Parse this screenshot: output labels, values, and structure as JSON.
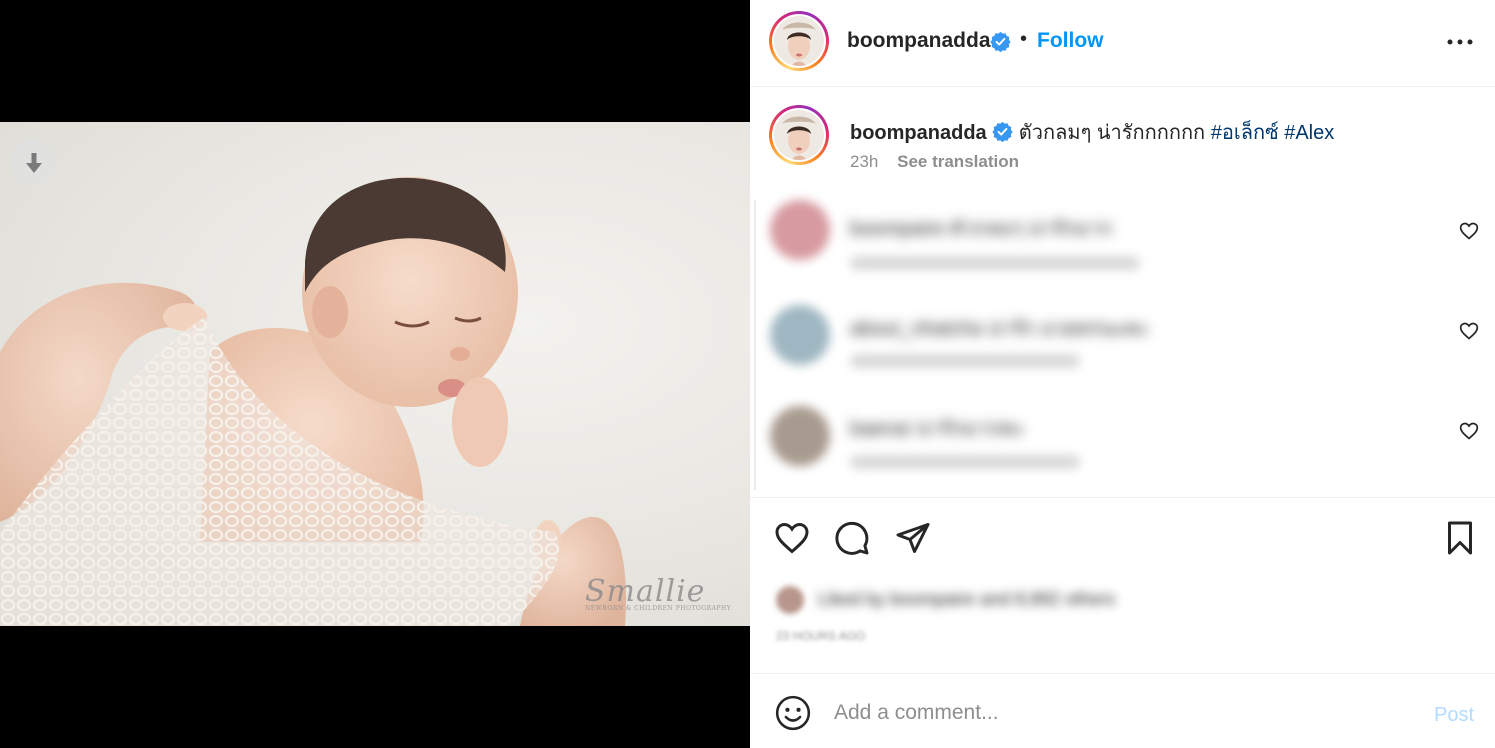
{
  "media": {
    "watermark": "Smallie",
    "watermark_sub": "NEWBORN & CHILDREN PHOTOGRAPHY"
  },
  "header": {
    "username": "boompanadda",
    "separator": "•",
    "follow_label": "Follow"
  },
  "caption": {
    "username": "boompanadda",
    "text": "ตัวกลมๆ น่ารักกกกกก",
    "hashtags": [
      "#อเล็กซ์",
      "#Alex"
    ],
    "time": "23h",
    "see_translation": "See translation"
  },
  "comments": [
    {
      "text": "boompaire ตัวกลมๆ น่ารักมาก",
      "meta": "13h  1 like  Reply  See translation",
      "avatar_color": "#d79aa0"
    },
    {
      "text": "about_nhatcha น่ารัก อวยพรนะคะ",
      "meta": "13h  Reply  See translation",
      "avatar_color": "#9fb7c2"
    },
    {
      "text": "baenai น่ารักมากคะ",
      "meta": "13h  Reply  See translation",
      "avatar_color": "#a89a8e"
    }
  ],
  "likes": {
    "text": "Liked by boompaire and 8,892 others",
    "time": "23 HOURS AGO"
  },
  "comment_box": {
    "placeholder": "Add a comment...",
    "post_label": "Post"
  },
  "colors": {
    "link": "#0095f6",
    "hashtag": "#00376b",
    "verified": "#3897f0",
    "post_disabled": "#b3dbff"
  },
  "icons": [
    "download-icon",
    "verified-icon",
    "more-options-icon",
    "heart-icon",
    "comment-icon",
    "share-icon",
    "bookmark-icon",
    "emoji-icon"
  ]
}
